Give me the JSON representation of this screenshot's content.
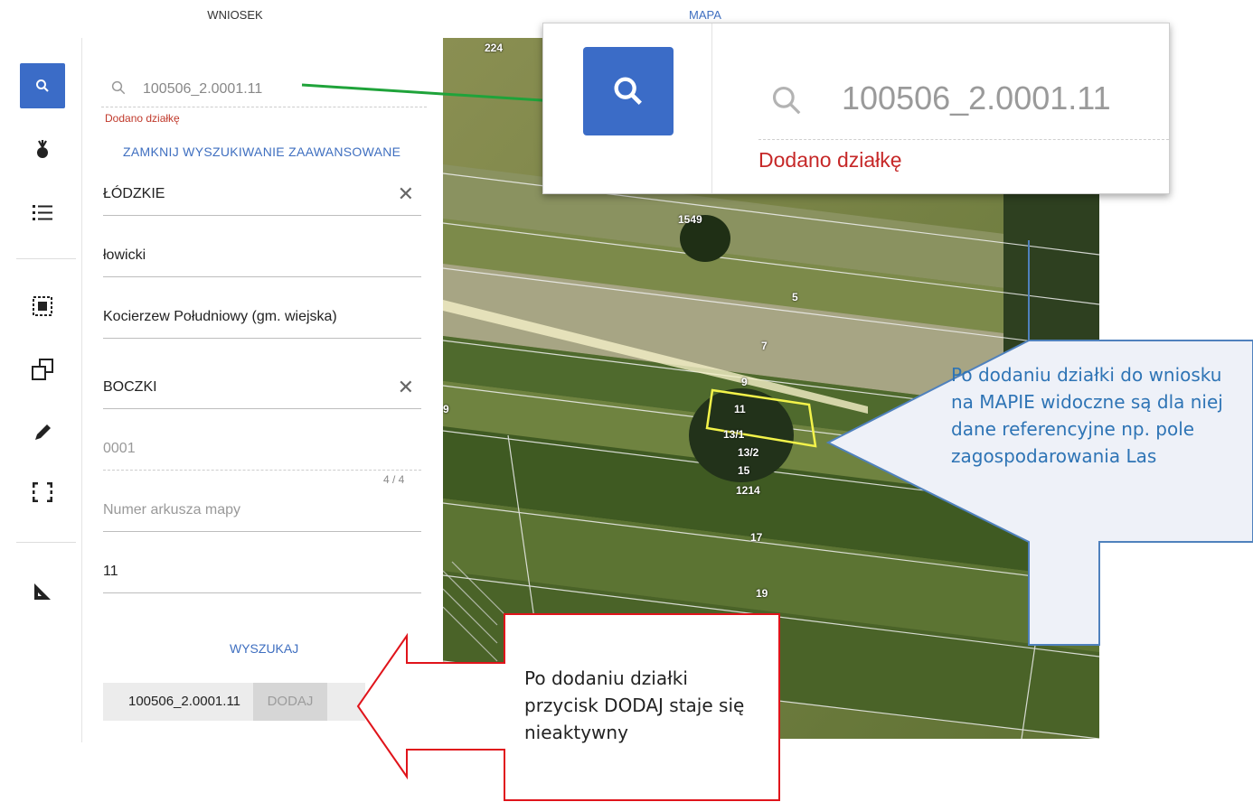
{
  "tabs": {
    "wniosek": "WNIOSEK",
    "mapa": "MAPA"
  },
  "search": {
    "value": "100506_2.0001.11",
    "message": "Dodano działkę",
    "advanced_toggle": "ZAMKNIJ WYSZUKIWANIE ZAAWANSOWANE",
    "submit_label": "WYSZUKAJ"
  },
  "form": {
    "wojewodztwo": "ŁÓDZKIE",
    "powiat": "łowicki",
    "gmina": "Kocierzew Południowy (gm. wiejska)",
    "obreb": "BOCZKI",
    "obreb_number_placeholder": "0001",
    "counter": "4 / 4",
    "arkusz_placeholder": "Numer arkusza mapy",
    "dzialka": "11"
  },
  "result": {
    "id": "100506_2.0001.11",
    "add_label": "DODAJ",
    "add_enabled": false
  },
  "map": {
    "parcel_labels": [
      "224",
      "1549",
      "5",
      "7",
      "9",
      "11",
      "13/1",
      "13/2",
      "15",
      "1214",
      "17",
      "19",
      "9"
    ]
  },
  "zoom_callout": {
    "search_value": "100506_2.0001.11",
    "message": "Dodano działkę"
  },
  "notes": {
    "blue": "Po dodaniu działki do wniosku na MAPIE widoczne są dla niej dane referencyjne np. pole zagospodarowania Las",
    "red": "Po dodaniu działki przycisk DODAJ staje się nieaktywny"
  },
  "colors": {
    "accent": "#3b6cc7",
    "error": "#c62828",
    "arrow_green": "#1fa33a",
    "arrow_red": "#e0141b",
    "callout_blue": "#4f81bd"
  },
  "icons": [
    "search-icon",
    "crop-icon",
    "list-icon",
    "select-area-icon",
    "copy-shapes-icon",
    "pencil-icon",
    "frame-icon",
    "ruler-icon"
  ]
}
